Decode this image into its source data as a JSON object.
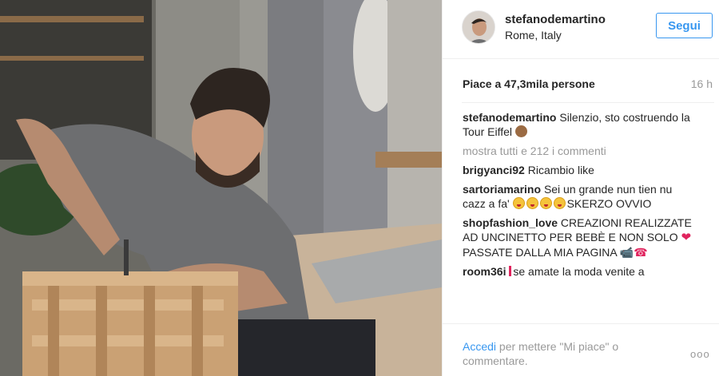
{
  "post": {
    "photo_alt": "Man assembling a wooden crate with a screwdriver"
  },
  "header": {
    "username": "stefanodemartino",
    "location": "Rome, Italy",
    "follow_label": "Segui"
  },
  "stats": {
    "likes": "Piace a 47,3mila persone",
    "time": "16 h"
  },
  "caption": {
    "author": "stefanodemartino",
    "text": "Silenzio, sto costruendo la Tour Eiffel"
  },
  "comments_link": "mostra tutti e 212 i commenti",
  "comments": [
    {
      "author": "brigyanci92",
      "text": "Ricambio like"
    },
    {
      "author": "sartoriamarino",
      "text_before": "Sei un grande nun tien nu cazz a fa'",
      "text_after": "SKERZO OVVIO"
    },
    {
      "author": "shopfashion_love",
      "text_before": "CREAZIONI REALIZZATE AD UNCINETTO PER BEBÈ E NON SOLO",
      "text_after": "PASSATE DALLA MIA PAGINA"
    },
    {
      "author": "room36i",
      "text": "se amate la moda venite a"
    }
  ],
  "footer": {
    "login_label": "Accedi",
    "login_suffix": "per mettere \"Mi piace\" o commentare.",
    "more_label": "ooo"
  },
  "colors": {
    "accent": "#3897f0",
    "text": "#262626",
    "muted": "#999999",
    "heart": "#e0245e"
  }
}
